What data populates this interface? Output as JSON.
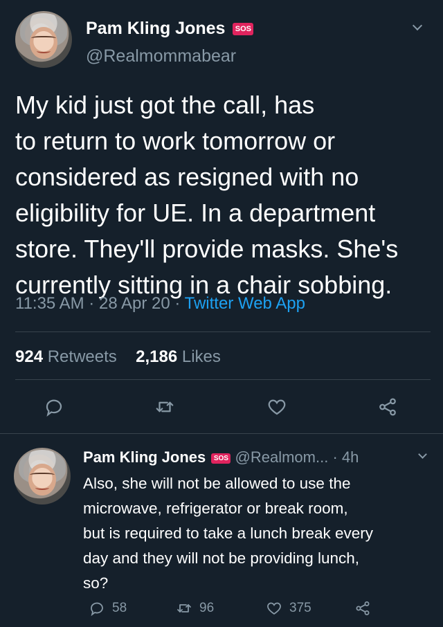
{
  "main_tweet": {
    "display_name": "Pam Kling Jones",
    "badge": "SOS",
    "handle": "@Realmommabear",
    "text": "My kid just got the call, has\nto return to work tomorrow or\nconsidered as resigned with no\neligibility for UE.  In a department\nstore. They'll provide masks.  She's\ncurrently sitting in a chair sobbing.",
    "time": "11:35 AM",
    "date": "28 Apr 20",
    "source": "Twitter Web App",
    "retweets_count": "924",
    "retweets_label": "Retweets",
    "likes_count": "2,186",
    "likes_label": "Likes",
    "icons": [
      "reply-icon",
      "retweet-icon",
      "like-icon",
      "share-icon",
      "chevron-down-icon"
    ]
  },
  "reply_tweet": {
    "display_name": "Pam Kling Jones",
    "badge": "SOS",
    "handle": "@Realmom...",
    "age": "4h",
    "text": "Also, she will not be allowed to use the\nmicrowave, refrigerator or break room,\nbut is required to take a lunch break every\nday and they will not be providing lunch,\nso?",
    "reply_count": "58",
    "retweet_count": "96",
    "like_count": "375"
  },
  "colors": {
    "background": "#15202b",
    "text": "#ffffff",
    "secondary": "#8899a6",
    "link": "#1da1f2",
    "badge": "#e0245e",
    "divider": "#38444d"
  }
}
